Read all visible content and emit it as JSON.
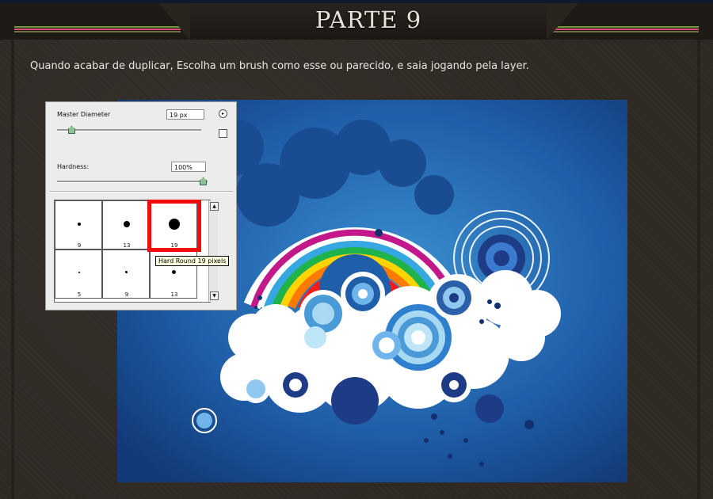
{
  "header": {
    "title": "PARTE 9"
  },
  "instruction": "Quando acabar de duplicar, Escolha um brush como esse ou parecido, e saia jogando pela layer.",
  "brush_panel": {
    "master_diameter_label": "Master Diameter",
    "master_diameter_value": "19 px",
    "hardness_label": "Hardness:",
    "hardness_value": "100%",
    "presets": [
      {
        "size": "9"
      },
      {
        "size": "13"
      },
      {
        "size": "19"
      },
      {
        "size": "5"
      },
      {
        "size": "9"
      },
      {
        "size": "13"
      }
    ],
    "selected_index": 2,
    "tooltip": "Hard Round 19 pixels"
  },
  "colors": {
    "highlight": "#ef0c0c",
    "background": "#2f2924",
    "rainbow": [
      "#c2188a",
      "#ffffff",
      "#36a7e0",
      "#1fb34b",
      "#ffd400",
      "#ff7a00",
      "#ff1a1a"
    ]
  }
}
